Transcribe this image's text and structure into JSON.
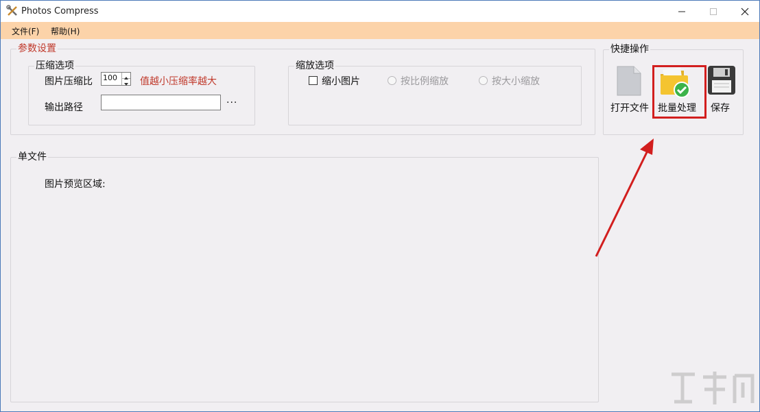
{
  "window": {
    "title": "Photos Compress"
  },
  "menu": {
    "file": "文件(F)",
    "help": "帮助(H)"
  },
  "params": {
    "title": "参数设置",
    "compress": {
      "title": "压缩选项",
      "ratio_label": "图片压缩比",
      "ratio_value": "100",
      "hint": "值越小压缩率越大",
      "output_label": "输出路径",
      "output_value": "",
      "browse": "···"
    },
    "scale": {
      "title": "缩放选项",
      "shrink": "缩小图片",
      "by_ratio": "按比例缩放",
      "by_size": "按大小缩放"
    }
  },
  "quick": {
    "title": "快捷操作",
    "open": "打开文件",
    "batch": "批量处理",
    "save": "保存"
  },
  "single": {
    "title": "单文件",
    "preview_label": "图片预览区域:"
  },
  "colors": {
    "menubar": "#fcd3a9",
    "accent_red": "#c0392b",
    "highlight": "#d21e1e"
  }
}
